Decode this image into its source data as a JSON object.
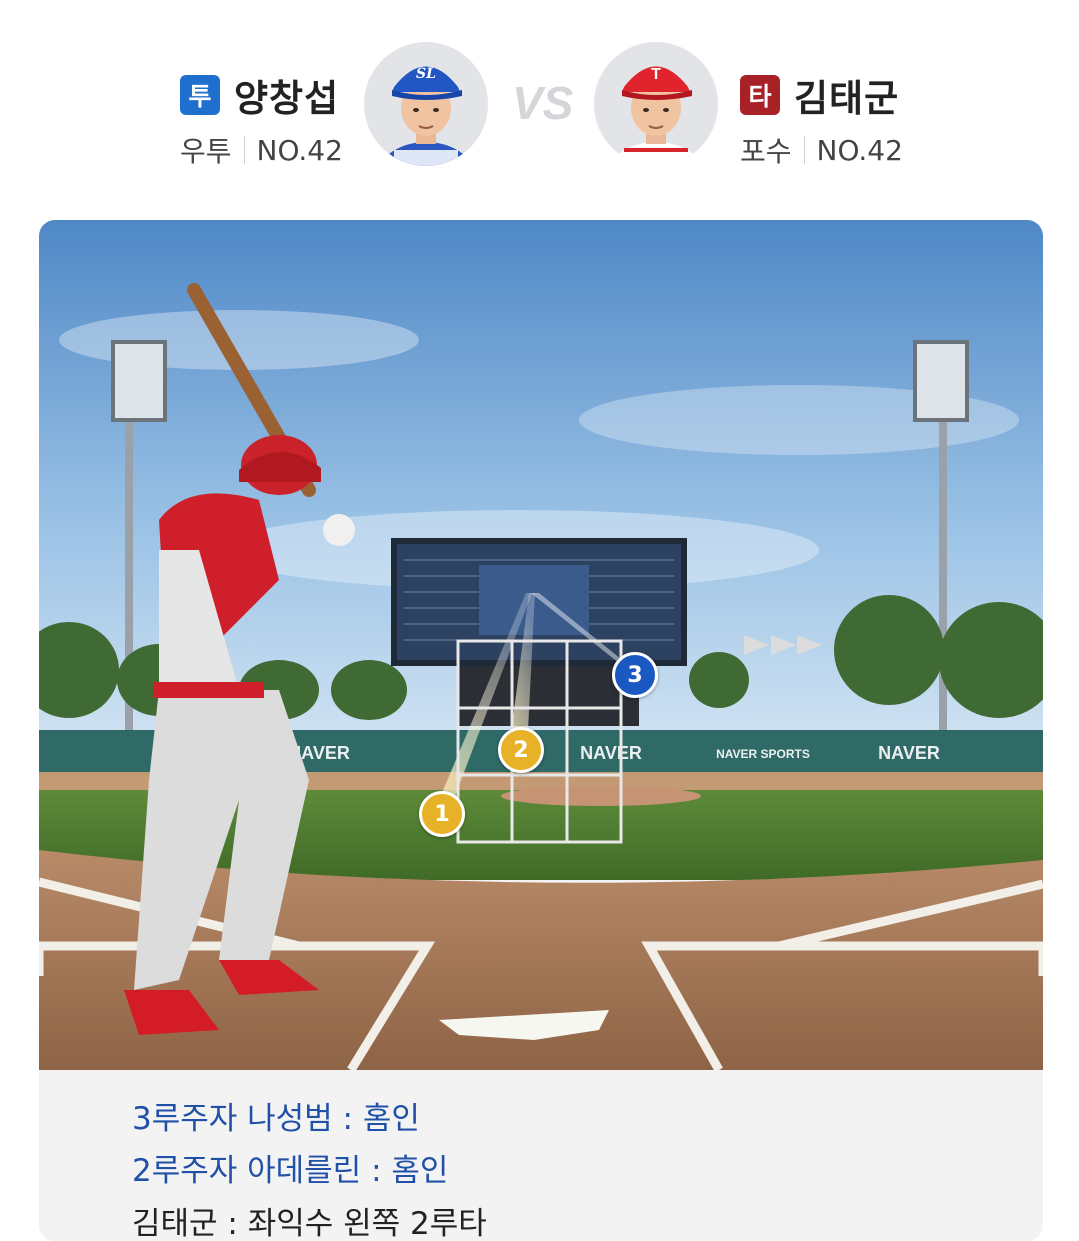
{
  "pitcher": {
    "role_badge": "투",
    "name": "양창섭",
    "throws": "우투",
    "number": "NO.42",
    "badge_color": "#1e6fce"
  },
  "vs_label": "VS",
  "batter": {
    "role_badge": "타",
    "name": "김태군",
    "position": "포수",
    "number": "NO.42",
    "badge_color": "#a82127"
  },
  "field": {
    "ad_banner": "NAVER",
    "ad_banner_sports": "NAVER SPORTS",
    "pitches": [
      {
        "number": "1",
        "color": "#e8b228"
      },
      {
        "number": "2",
        "color": "#e8b228"
      },
      {
        "number": "3",
        "color": "#1a58c2"
      }
    ]
  },
  "play_log": [
    {
      "text": "3루주자 나성범 : 홈인",
      "color": "#2150a8"
    },
    {
      "text": "2루주자 아데를린 : 홈인",
      "color": "#2150a8"
    },
    {
      "text": "김태군 : 좌익수 왼쪽 2루타",
      "color": "#222222"
    }
  ]
}
